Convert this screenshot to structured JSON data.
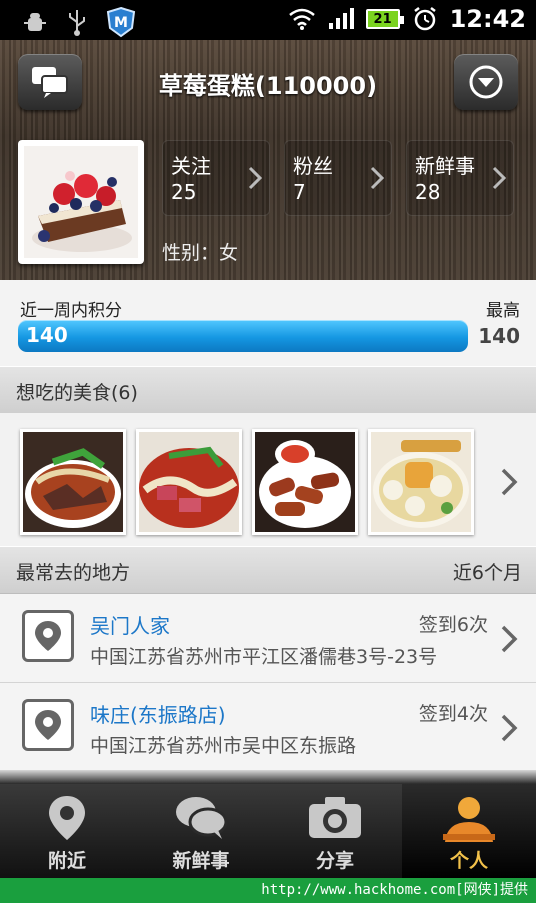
{
  "status_bar": {
    "time": "12:42",
    "battery": "21"
  },
  "header": {
    "title": "草莓蛋糕(110000)"
  },
  "profile": {
    "stats": [
      {
        "label": "关注",
        "value": "25"
      },
      {
        "label": "粉丝",
        "value": "7"
      },
      {
        "label": "新鲜事",
        "value": "28"
      }
    ],
    "gender": "性别：女"
  },
  "score": {
    "label": "近一周内积分",
    "value": "140",
    "max_label": "最高",
    "max_value": "140",
    "fraction": 1.0
  },
  "foods_section": {
    "title": "想吃的美食(6)"
  },
  "places_section": {
    "title": "最常去的地方",
    "period": "近6个月"
  },
  "places": [
    {
      "name": "吴门人家",
      "checkins": "签到6次",
      "address": "中国江苏省苏州市平江区潘儒巷3号-23号"
    },
    {
      "name": "味庄(东振路店)",
      "checkins": "签到4次",
      "address": "中国江苏省苏州市吴中区东振路"
    }
  ],
  "nav": [
    {
      "label": "附近",
      "icon": "location-pin-icon"
    },
    {
      "label": "新鲜事",
      "icon": "chat-bubbles-icon"
    },
    {
      "label": "分享",
      "icon": "camera-icon"
    },
    {
      "label": "个人",
      "icon": "person-icon"
    }
  ],
  "watermark": "http://www.hackhome.com[网侠]提供",
  "colors": {
    "accent": "#1c77c8",
    "progress": "#1597e2",
    "active_tab": "#f2c14a"
  }
}
